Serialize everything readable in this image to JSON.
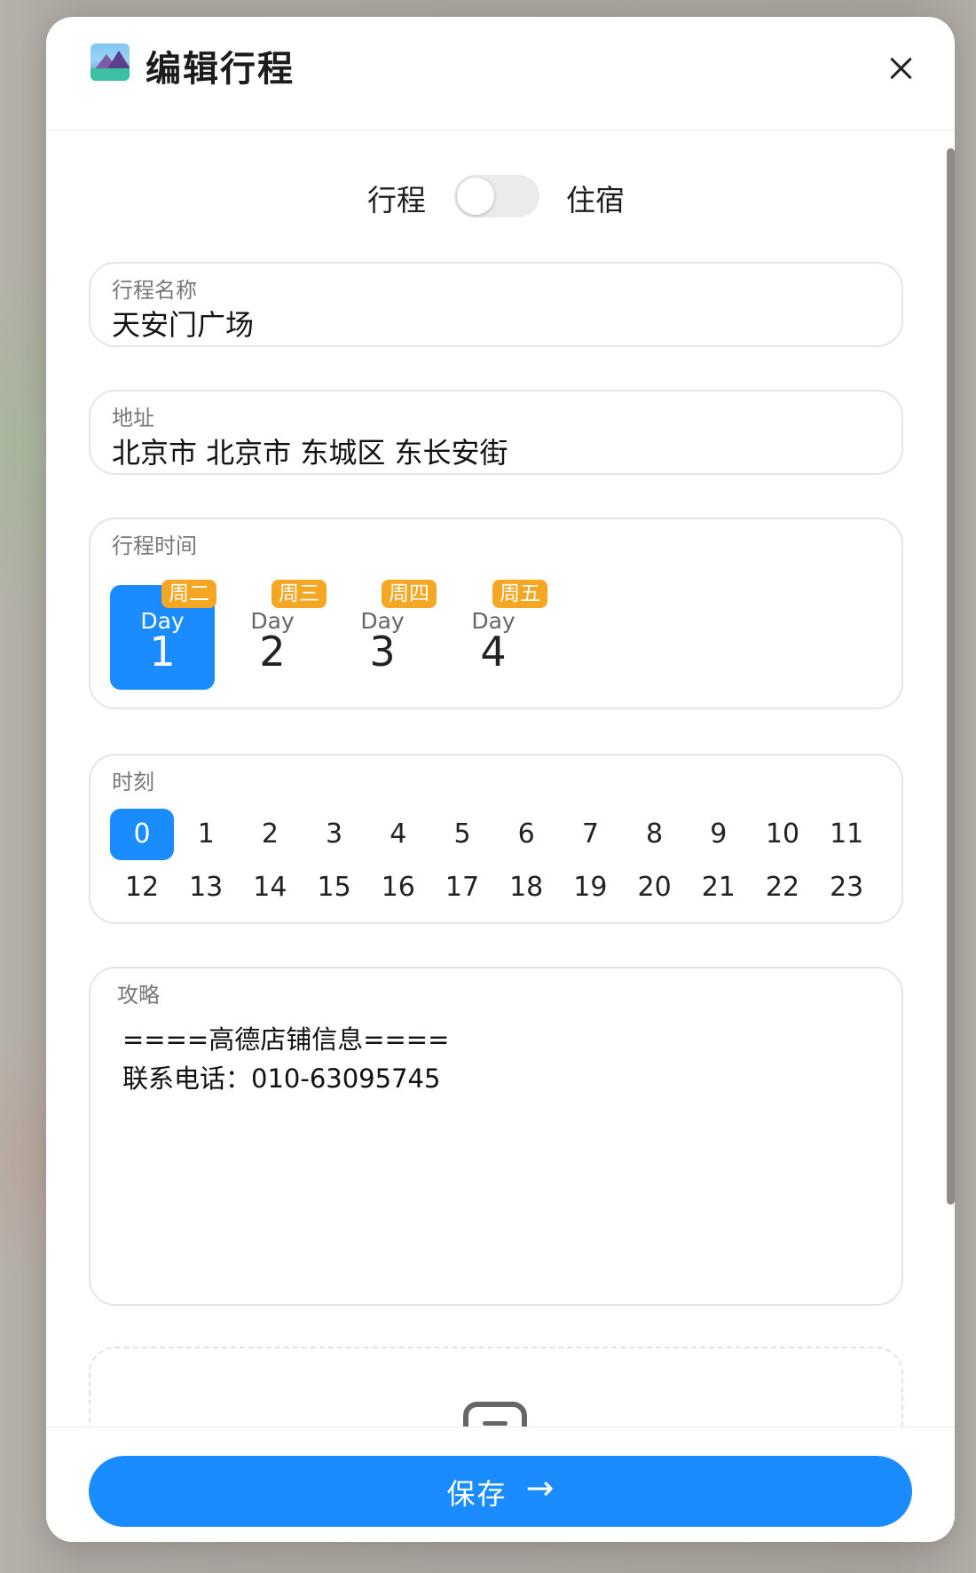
{
  "header": {
    "title": "编辑行程",
    "close_icon": "close-icon",
    "logo_icon": "landscape-icon"
  },
  "mode_toggle": {
    "left_label": "行程",
    "right_label": "住宿",
    "is_on": false
  },
  "fields": {
    "name": {
      "label": "行程名称",
      "value": "天安门广场"
    },
    "address": {
      "label": "地址",
      "value": "北京市 北京市 东城区 东长安街"
    },
    "days": {
      "label": "行程时间",
      "items": [
        {
          "weekday": "周二",
          "prefix": "Day",
          "number": "1",
          "selected": true
        },
        {
          "weekday": "周三",
          "prefix": "Day",
          "number": "2",
          "selected": false
        },
        {
          "weekday": "周四",
          "prefix": "Day",
          "number": "3",
          "selected": false
        },
        {
          "weekday": "周五",
          "prefix": "Day",
          "number": "4",
          "selected": false
        }
      ]
    },
    "hours": {
      "label": "时刻",
      "items": [
        "0",
        "1",
        "2",
        "3",
        "4",
        "5",
        "6",
        "7",
        "8",
        "9",
        "10",
        "11",
        "12",
        "13",
        "14",
        "15",
        "16",
        "17",
        "18",
        "19",
        "20",
        "21",
        "22",
        "23"
      ],
      "selected": "0"
    },
    "notes": {
      "label": "攻略",
      "line1": "====高德店铺信息====",
      "line2": "联系电话：010-63095745"
    },
    "upload": {
      "icon": "image-upload-icon"
    }
  },
  "footer": {
    "save_label": "保存",
    "arrow_icon": "arrow-right-icon",
    "arrow_glyph": "→"
  },
  "colors": {
    "accent": "#1a8cff",
    "weekday_badge": "#f5a623"
  }
}
